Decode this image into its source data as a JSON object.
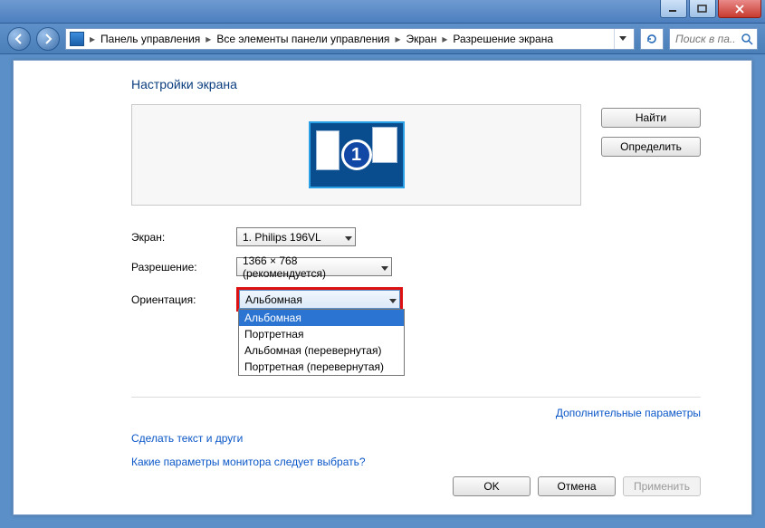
{
  "window_controls": {
    "minimize": "_",
    "maximize": "□",
    "close": "×"
  },
  "breadcrumb": {
    "root": "Панель управления",
    "all": "Все элементы панели управления",
    "screen": "Экран",
    "resolution": "Разрешение экрана"
  },
  "search": {
    "placeholder": "Поиск в па..."
  },
  "page_title": "Настройки экрана",
  "side_buttons": {
    "find": "Найти",
    "identify": "Определить"
  },
  "monitor_number": "1",
  "form": {
    "display_label": "Экран:",
    "display_value": "1. Philips 196VL",
    "resolution_label": "Разрешение:",
    "resolution_value": "1366 × 768 (рекомендуется)",
    "orientation_label": "Ориентация:",
    "orientation_value": "Альбомная",
    "orientation_options": [
      "Альбомная",
      "Портретная",
      "Альбомная (перевернутая)",
      "Портретная (перевернутая)"
    ]
  },
  "links": {
    "advanced": "Дополнительные параметры",
    "text_size": "Сделать текст и други",
    "help": "Какие параметры монитора следует выбрать?"
  },
  "actions": {
    "ok": "OK",
    "cancel": "Отмена",
    "apply": "Применить"
  }
}
